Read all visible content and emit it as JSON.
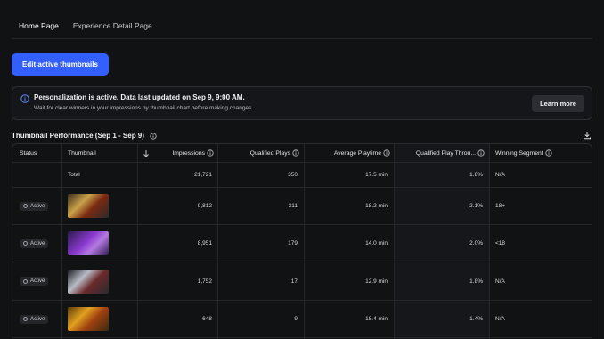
{
  "tabs": [
    {
      "label": "Home Page",
      "active": true
    },
    {
      "label": "Experience Detail Page",
      "active": false
    }
  ],
  "edit_button": "Edit active thumbnails",
  "banner": {
    "title": "Personalization is active. Data last updated on Sep 9, 9:00 AM.",
    "subtitle": "Wait for clear winners in your impressions by thumbnail chart before making changes.",
    "learn_more": "Learn more"
  },
  "section": {
    "title": "Thumbnail Performance (Sep 1 - Sep 9)"
  },
  "table": {
    "columns": [
      "Status",
      "Thumbnail",
      "Impressions",
      "Qualified Plays",
      "Average Playtime",
      "Qualified Play Throu...",
      "Winning Segment"
    ],
    "total": {
      "label": "Total",
      "impressions": "21,721",
      "qualified_plays": "350",
      "avg_playtime": "17.5 min",
      "qpt": "1.8%",
      "segment": "N/A"
    },
    "rows": [
      {
        "status": "Active",
        "impressions": "9,812",
        "qualified_plays": "311",
        "avg_playtime": "18.2 min",
        "qpt": "2.1%",
        "segment": "18+"
      },
      {
        "status": "Active",
        "impressions": "8,951",
        "qualified_plays": "179",
        "avg_playtime": "14.0 min",
        "qpt": "2.0%",
        "segment": "<18"
      },
      {
        "status": "Active",
        "impressions": "1,752",
        "qualified_plays": "17",
        "avg_playtime": "12.9 min",
        "qpt": "1.8%",
        "segment": "N/A"
      },
      {
        "status": "Active",
        "impressions": "648",
        "qualified_plays": "9",
        "avg_playtime": "18.4 min",
        "qpt": "1.4%",
        "segment": "N/A"
      }
    ]
  },
  "colors": {
    "accent": "#335fff",
    "background": "#111214"
  },
  "icons": [
    "info-icon",
    "download-icon",
    "sort-down-arrow-icon"
  ]
}
